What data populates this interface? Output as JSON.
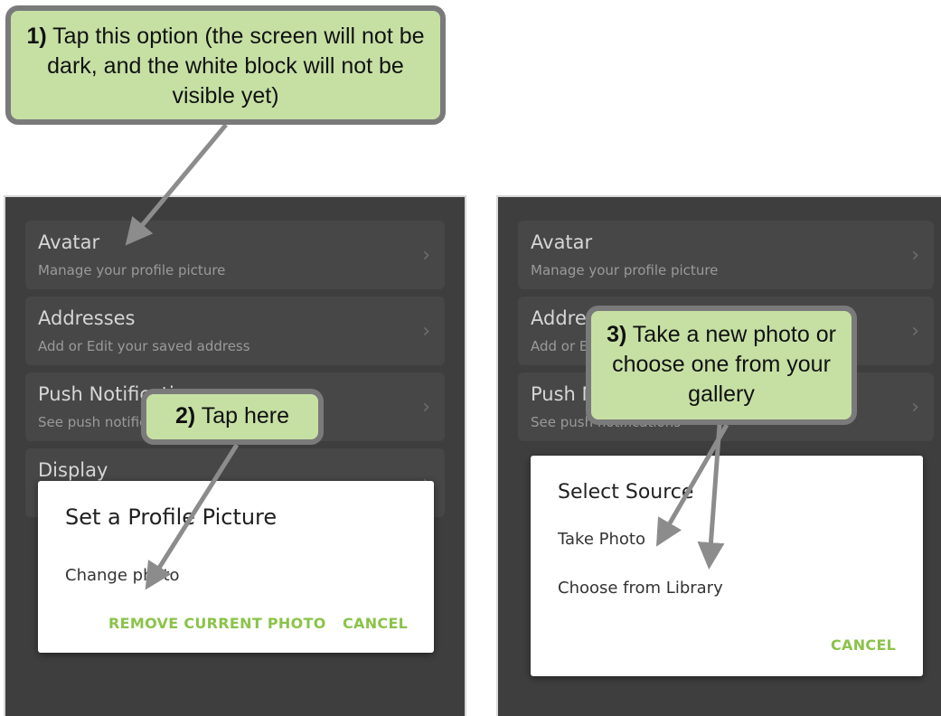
{
  "callouts": {
    "step1": {
      "num": "1)",
      "text": " Tap this option (the screen will not be dark, and the white block will not be visible yet)"
    },
    "step2": {
      "num": "2)",
      "text": " Tap here"
    },
    "step3": {
      "num": "3)",
      "text": " Take a new photo or choose one from your gallery"
    }
  },
  "left_screen": {
    "menu": [
      {
        "title": "Avatar",
        "subtitle": "Manage your profile picture"
      },
      {
        "title": "Addresses",
        "subtitle": "Add or Edit your saved address"
      },
      {
        "title": "Push Notifications",
        "subtitle": "See push notifications"
      },
      {
        "title": "Display",
        "subtitle": ""
      }
    ],
    "dialog": {
      "title": "Set a Profile Picture",
      "option": "Change photo",
      "remove_label": "REMOVE CURRENT PHOTO",
      "cancel_label": "CANCEL"
    }
  },
  "right_screen": {
    "menu": [
      {
        "title": "Avatar",
        "subtitle": "Manage your profile picture"
      },
      {
        "title": "Addresses",
        "subtitle": "Add or Edit your saved address"
      },
      {
        "title": "Push Notifications",
        "subtitle": "See push notifications"
      }
    ],
    "dialog": {
      "title": "Select Source",
      "options": [
        "Take Photo",
        "Choose from Library"
      ],
      "cancel_label": "CANCEL"
    }
  },
  "colors": {
    "accent": "#8bc34a",
    "callout_fill": "#c6e0a4",
    "overlay": "#3e3e3e"
  },
  "icons": {
    "chevron": "chevron-right-icon"
  }
}
